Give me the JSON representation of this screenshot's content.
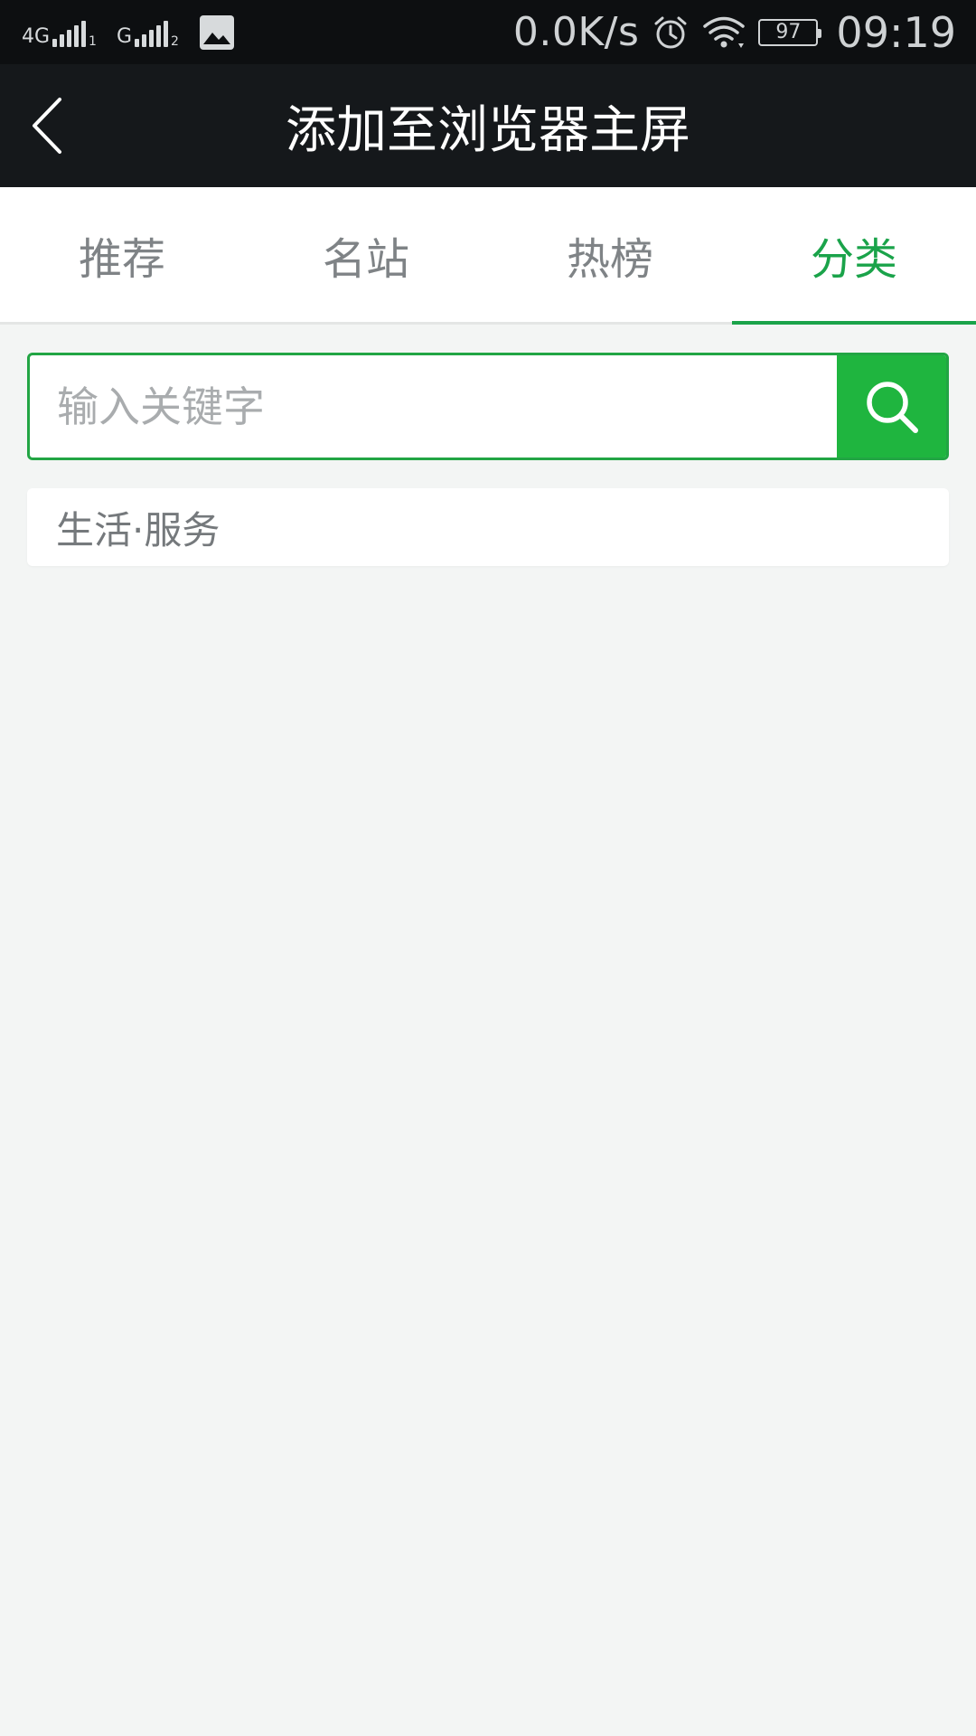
{
  "status_bar": {
    "signal_1_label": "4G",
    "signal_1_sub": "1",
    "signal_2_label": "G",
    "signal_2_sub": "2",
    "net_speed": "0.0K/s",
    "battery_level": "97",
    "time": "09:19",
    "icons": [
      "signal-4g-icon",
      "signal-g-icon",
      "gallery-icon",
      "alarm-icon",
      "wifi-icon",
      "battery-icon"
    ]
  },
  "header": {
    "title": "添加至浏览器主屏",
    "back_icon": "chevron-left-icon"
  },
  "tabs": [
    {
      "label": "推荐",
      "active": false
    },
    {
      "label": "名站",
      "active": false
    },
    {
      "label": "热榜",
      "active": false
    },
    {
      "label": "分类",
      "active": true
    }
  ],
  "search": {
    "placeholder": "输入关键字",
    "value": "",
    "button_icon": "search-icon"
  },
  "categories": [
    {
      "label": "生活·服务"
    }
  ],
  "colors": {
    "accent": "#1aa34a",
    "search_button": "#1fb53f",
    "title_bar": "#15181b",
    "status_bar": "#0d0f11",
    "background": "#f3f5f4"
  }
}
